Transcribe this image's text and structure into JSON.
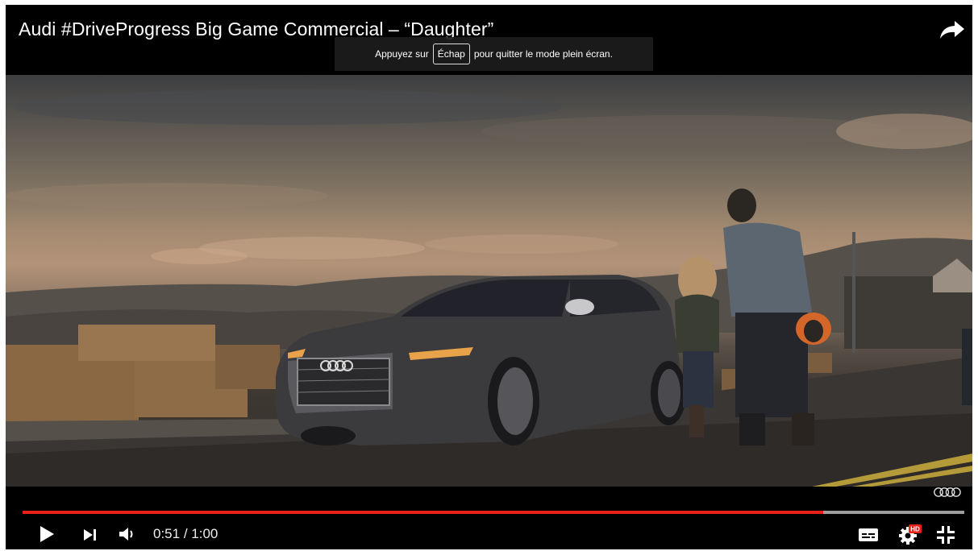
{
  "video": {
    "title": "Audi #DriveProgress Big Game Commercial – “Daughter”"
  },
  "fullscreen_notice": {
    "before": "Appuyez sur",
    "key": "Échap",
    "after": "pour quitter le mode plein écran."
  },
  "player": {
    "current_time": "0:51",
    "separator": "/",
    "duration": "1:00",
    "played_fraction": 0.85,
    "loaded_fraction": 1.0,
    "hd_badge": "HD",
    "progress_color": "#e62117"
  },
  "icons": {
    "share": "share-icon",
    "play": "play-icon",
    "next": "next-icon",
    "volume": "volume-icon",
    "subtitles": "subtitles-icon",
    "settings": "settings-icon",
    "exit_fullscreen": "exit-fullscreen-icon",
    "brand": "audi-rings-logo"
  }
}
